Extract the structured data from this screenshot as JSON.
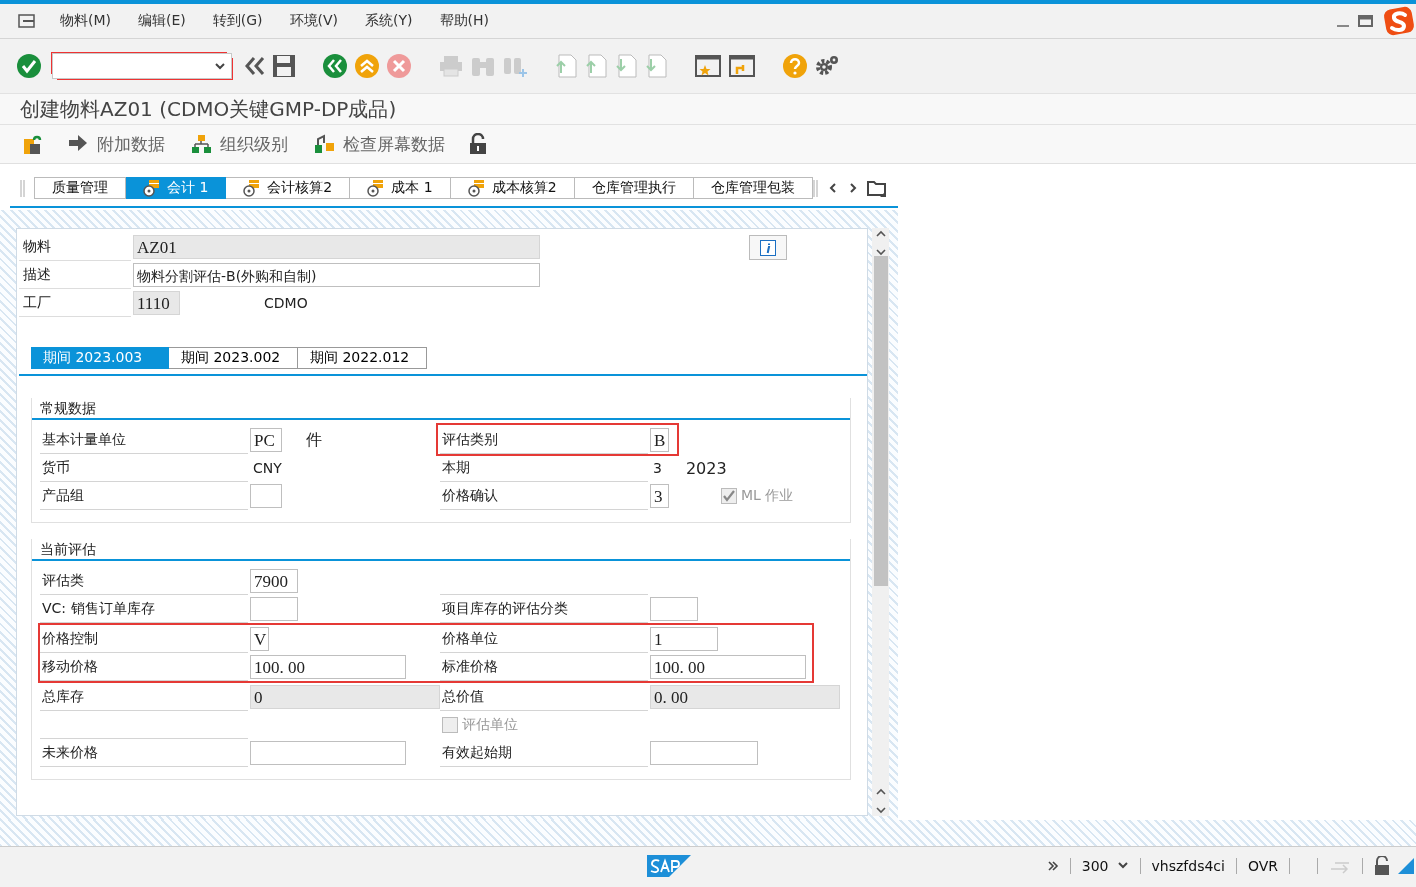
{
  "menu": [
    "物料(M)",
    "编辑(E)",
    "转到(G)",
    "环境(V)",
    "系统(Y)",
    "帮助(H)"
  ],
  "title": "创建物料AZ01 (CDMO关键GMP-DP成品)",
  "app_toolbar": [
    {
      "kind": "icon"
    },
    {
      "kind": "text",
      "label": "附加数据"
    },
    {
      "kind": "text",
      "label": "组织级别"
    },
    {
      "kind": "text",
      "label": "检查屏幕数据"
    },
    {
      "kind": "lock"
    }
  ],
  "tabs": [
    {
      "label": "质量管理",
      "selected": false,
      "has_icon": false
    },
    {
      "label": "会计 1",
      "selected": true,
      "has_icon": true
    },
    {
      "label": "会计核算2",
      "selected": false,
      "has_icon": true
    },
    {
      "label": "成本 1",
      "selected": false,
      "has_icon": true
    },
    {
      "label": "成本核算2",
      "selected": false,
      "has_icon": true
    },
    {
      "label": "仓库管理执行",
      "selected": false,
      "has_icon": false
    },
    {
      "label": "仓库管理包装",
      "selected": false,
      "has_icon": false
    }
  ],
  "header": [
    {
      "label": "物料",
      "value": "AZ01",
      "kind": "readonly"
    },
    {
      "label": "描述",
      "value": "物料分割评估-B(外购和自制)",
      "kind": "input"
    },
    {
      "label": "工厂",
      "value": "1110",
      "kind": "readonly",
      "suffix": "CDMO"
    }
  ],
  "periods": [
    {
      "label": "期间 2023.003",
      "selected": true
    },
    {
      "label": "期间 2023.002",
      "selected": false
    },
    {
      "label": "期间 2022.012",
      "selected": false
    }
  ],
  "general": {
    "title": "常规数据",
    "rows": [
      {
        "left": {
          "kind": "input",
          "label": "基本计量单位",
          "value": "PC",
          "suffix": "件"
        },
        "right": {
          "kind": "input",
          "label": "评估类别",
          "value": "B",
          "highlighted": true
        }
      },
      {
        "left": {
          "kind": "text",
          "label": "货币",
          "value": "CNY"
        },
        "right": {
          "kind": "text",
          "label": "本期",
          "value": "3",
          "suffix": "2023",
          "highlighted": false
        }
      },
      {
        "left": {
          "kind": "input",
          "label": "产品组"
        },
        "right": {
          "kind": "input",
          "label": "价格确认",
          "value": "3",
          "highlighted": false,
          "check": {
            "label": "ML 作业",
            "checked": true,
            "disabled": true
          }
        }
      }
    ]
  },
  "valuation": {
    "title": "当前评估",
    "rows": [
      {
        "highlighted": false,
        "left": {
          "kind": "input",
          "label": "评估类",
          "value": "7900"
        }
      },
      {
        "highlighted": false,
        "left": {
          "kind": "input",
          "label": "VC: 销售订单库存"
        },
        "right": {
          "kind": "input",
          "label": "项目库存的评估分类"
        }
      },
      {
        "highlighted": true,
        "left": {
          "kind": "input",
          "label": "价格控制",
          "value": "V"
        },
        "right": {
          "kind": "input",
          "label": "价格单位",
          "value": "1"
        }
      },
      {
        "highlighted": true,
        "left": {
          "kind": "input",
          "label": "移动价格",
          "value": "100. 00"
        },
        "right": {
          "kind": "input",
          "label": "标准价格",
          "value": "100. 00"
        }
      },
      {
        "highlighted": false,
        "left": {
          "kind": "readonly",
          "label": "总库存",
          "value": "0"
        },
        "right": {
          "kind": "readonly",
          "label": "总价值",
          "value": "0. 00"
        }
      },
      {
        "highlighted": false,
        "right": {
          "kind": "checkbox",
          "label": "评估单位",
          "checked": false,
          "disabled": true
        }
      },
      {
        "highlighted": false,
        "left": {
          "kind": "input",
          "label": "未来价格"
        },
        "right": {
          "kind": "input",
          "label": "有效起始期"
        }
      }
    ]
  },
  "status_bar": {
    "client": "300",
    "server": "vhszfds4ci",
    "mode": "OVR"
  }
}
